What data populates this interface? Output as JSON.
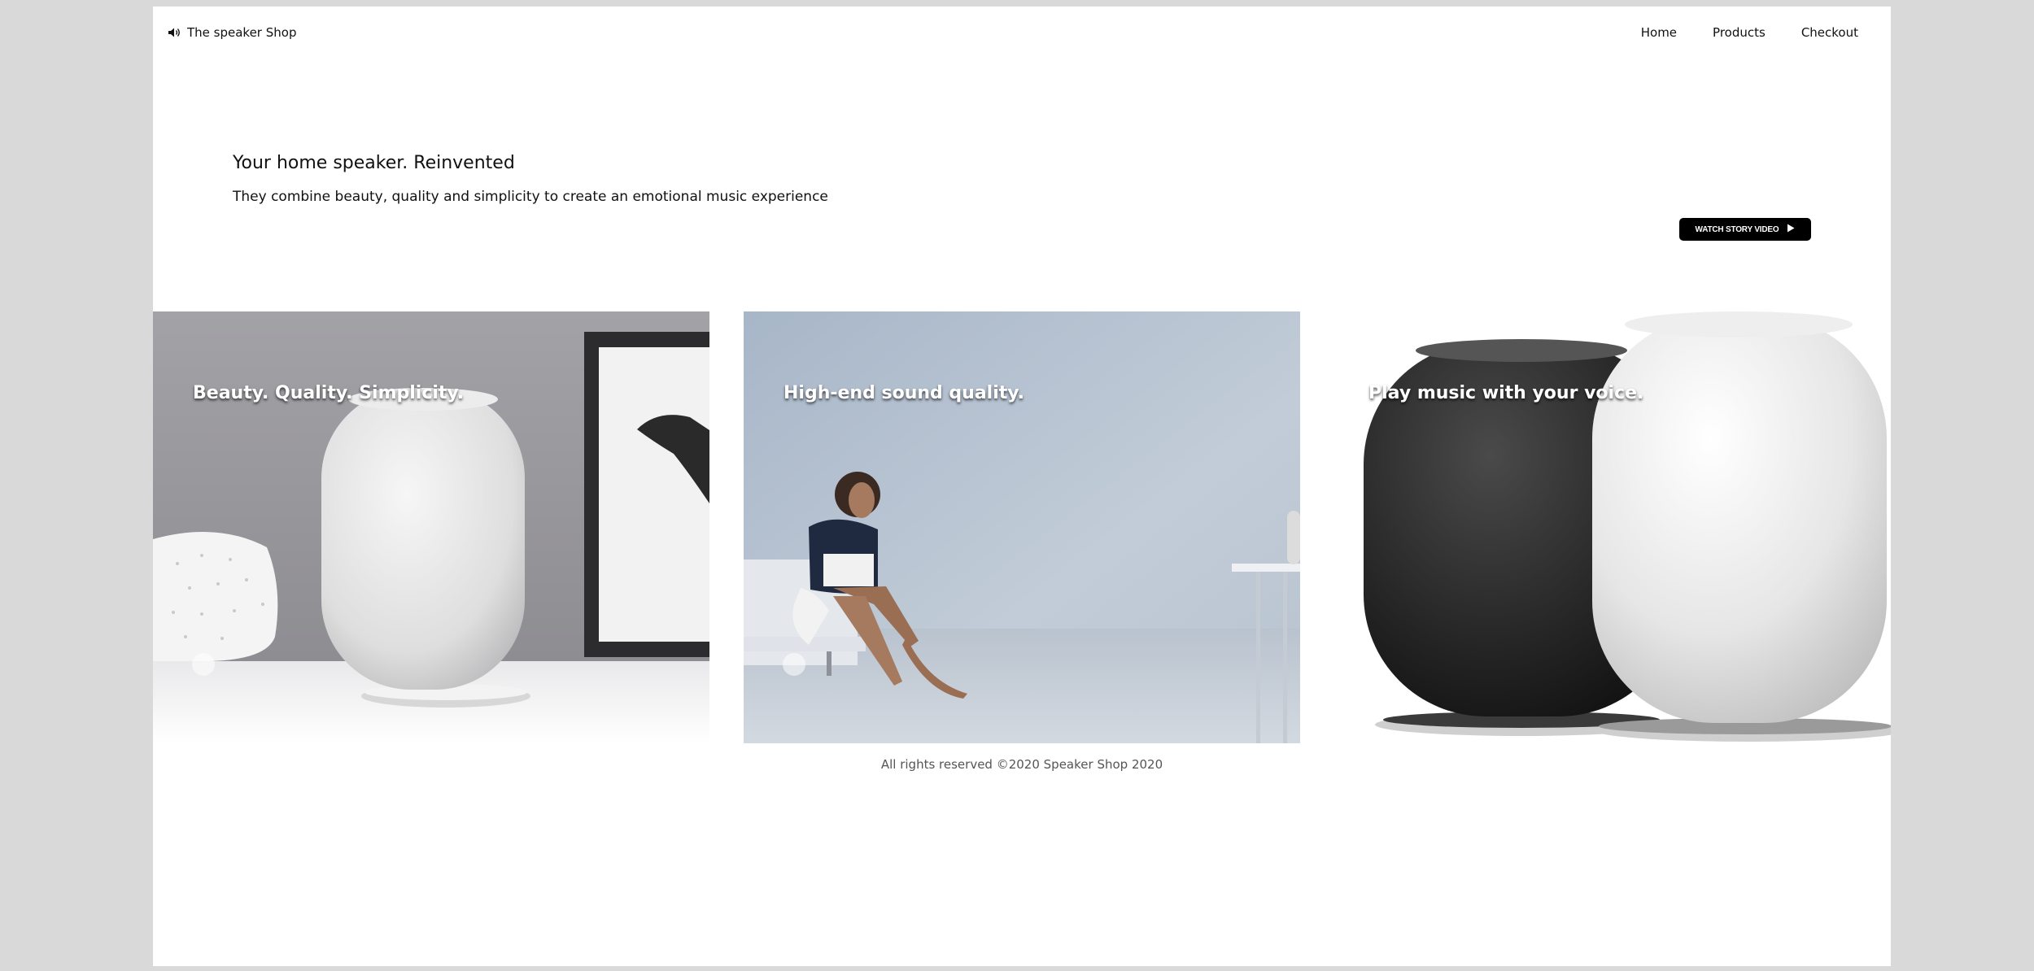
{
  "header": {
    "brand_label": "The speaker Shop",
    "brand_icon": "speaker-icon",
    "nav": [
      {
        "label": "Home"
      },
      {
        "label": "Products"
      },
      {
        "label": "Checkout"
      }
    ]
  },
  "hero": {
    "title": "Your home speaker. Reinvented",
    "subtitle": "They combine beauty, quality and simplicity to create an emotional music experience",
    "watch_button_label": "WATCH STORY VIDEO",
    "watch_button_icon": "play-icon"
  },
  "cards": [
    {
      "caption": "Beauty. Quality. Simplicity."
    },
    {
      "caption": "High-end sound quality."
    },
    {
      "caption": "Play music with your voice."
    }
  ],
  "footer": {
    "text": "All rights reserved ©2020 Speaker Shop 2020"
  },
  "colors": {
    "page_background": "#d9d9d9",
    "content_background": "#ffffff",
    "button_background": "#000000",
    "text": "#111111"
  }
}
